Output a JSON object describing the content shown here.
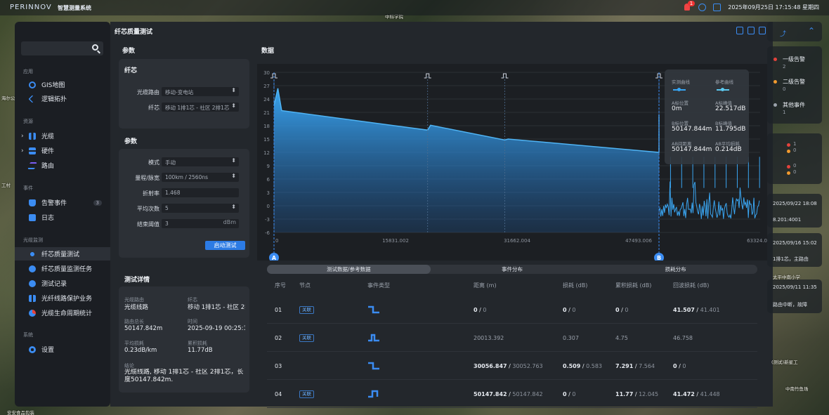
{
  "app": {
    "logo": "PERINNOV",
    "system_title": "智慧测量系统",
    "datetime": "2025年09月25日 17:15:48 星期四",
    "alarm_count": "1"
  },
  "map_labels": [
    "海尔",
    "中科学院",
    "海尔公寓",
    "工村",
    "安安食品包装",
    "(测试)新星工",
    "太平中南小学",
    "中南竹鱼场",
    "路由中断，故障",
    "1排1芯，主路由"
  ],
  "sidebar": {
    "sections": {
      "apps": "应用",
      "resources": "资源",
      "events": "事件",
      "fiber_monitor": "光缆监测",
      "system": "系统"
    },
    "items": {
      "gis": "GIS地图",
      "topology": "逻辑拓扑",
      "cable": "光缆",
      "hardware": "硬件",
      "route": "路由",
      "alarm": "告警事件",
      "alarm_count": "3",
      "log": "日志",
      "quality_test": "纤芯质量测试",
      "quality_task": "纤芯质量监测任务",
      "test_record": "测试记录",
      "protection": "光纤线路保护业务",
      "lifecycle": "光缆生命周期统计",
      "settings": "设置"
    }
  },
  "main": {
    "title": "纤芯质量测试",
    "params_header": "参数",
    "data_header": "数据",
    "fiber": {
      "header": "纤芯",
      "route_label": "光缆路由",
      "route_value": "移动-变电站",
      "core_label": "纤芯",
      "core_value": "移动 1排1芯 - 社区 2排1芯"
    },
    "params": {
      "header": "参数",
      "mode_label": "模式",
      "mode_value": "手动",
      "range_label": "量程/脉宽",
      "range_value": "100km / 2560ns",
      "refr_label": "折射率",
      "refr_value": "1.468",
      "avg_label": "平均次数",
      "avg_value": "5",
      "end_label": "结束阈值",
      "end_value": "3",
      "end_unit": "dBm",
      "start_button": "启动测试"
    },
    "details": {
      "header": "测试详情",
      "route_label": "光缆路由",
      "route_value": "光缆线路",
      "core_label": "纤芯",
      "core_value": "移动 1排1芯 - 社区 2排1芯",
      "len_label": "路由总长",
      "len_value": "50147.842m",
      "time_label": "时间",
      "time_value": "2025-09-19 00:25:17",
      "avgloss_label": "平均损耗",
      "avgloss_value": "0.23dB/km",
      "cumloss_label": "累积损耗",
      "cumloss_value": "11.77dB",
      "conclusion_label": "结论",
      "conclusion_value": "光缆线路, 移动 1排1芯 - 社区 2排1芯，长度50147.842m."
    }
  },
  "legend": {
    "measured": "实测曲线",
    "reference": "参考曲线",
    "a_pos_label": "A标位置",
    "a_pos": "0m",
    "a_peak_label": "A标峰值",
    "a_peak": "22.517dB",
    "b_pos_label": "B标位置",
    "b_pos": "50147.844m",
    "b_peak_label": "B标峰值",
    "b_peak": "11.795dB",
    "ab_dist_label": "AB间距离",
    "ab_dist": "50147.844m",
    "ab_loss_label": "AB平均损耗",
    "ab_loss": "0.214dB"
  },
  "chart_data": {
    "type": "area",
    "x_ticks": [
      "0",
      "15831.002",
      "31662.004",
      "47493.006",
      "63324.009"
    ],
    "y_ticks": [
      "30",
      "27",
      "24",
      "21",
      "18",
      "15",
      "12",
      "9",
      "6",
      "3",
      "0",
      "-3",
      "-6"
    ],
    "ylim": [
      -6,
      30
    ],
    "xlim": [
      0,
      63324.009
    ],
    "series": [
      {
        "name": "实测曲线",
        "x": [
          0,
          500,
          1000,
          20013,
          20400,
          30056,
          30500,
          50147,
          50147.842,
          50300,
          63324
        ],
        "y": [
          22.5,
          26.4,
          21.4,
          17.0,
          18.1,
          14.8,
          15.0,
          12.0,
          20.5,
          -1.0,
          -2.0
        ]
      }
    ],
    "markers": {
      "A": 0,
      "B": 50147.842
    },
    "event_x": [
      0,
      20013.392,
      30056.847,
      50147.842
    ]
  },
  "table": {
    "tabs": [
      "测试数据/参考数据",
      "事件分布",
      "损耗分布"
    ],
    "headers": [
      "序号",
      "节点",
      "事件类型",
      "距离 (m)",
      "损耗 (dB)",
      "累积损耗 (dB)",
      "回波损耗 (dB)"
    ],
    "rows": [
      {
        "idx": "01",
        "tag": "关联",
        "dist": "0",
        "dist_ref": "0",
        "loss": "0",
        "loss_ref": "0",
        "cum": "0",
        "cum_ref": "0",
        "ret": "41.507",
        "ret_ref": "41.401"
      },
      {
        "idx": "02",
        "tag": "关联",
        "dist": "20013.392",
        "loss": "0.307",
        "cum": "4.75",
        "ret": "46.758"
      },
      {
        "idx": "03",
        "tag": "",
        "dist": "30056.847",
        "dist_ref": "30052.763",
        "loss": "0.509",
        "loss_ref": "0.583",
        "cum": "7.291",
        "cum_ref": "7.564",
        "ret": "0",
        "ret_ref": "0"
      },
      {
        "idx": "04",
        "tag": "关联",
        "dist": "50147.842",
        "dist_ref": "50147.842",
        "loss": "0",
        "loss_ref": "0",
        "cum": "11.77",
        "cum_ref": "12.045",
        "ret": "41.472",
        "ret_ref": "41.448"
      }
    ]
  },
  "right_panel": {
    "alarm1": "一级告警",
    "alarm1_count": "2",
    "alarm2": "二级告警",
    "alarm2_count": "0",
    "other": "其他事件",
    "other_count": "1",
    "c1": "1",
    "c2": "0",
    "c3": "0",
    "c4": "0",
    "t1": "2025/09/22 18:08",
    "ip": "8.201:4001",
    "t2": "2025/09/16 15:02",
    "t3": "2025/09/11 11:35"
  },
  "colors": {
    "accent": "#2c7be5",
    "curve": "#37a5f3",
    "alarm1": "#e5423c",
    "alarm2": "#f29a2e"
  }
}
